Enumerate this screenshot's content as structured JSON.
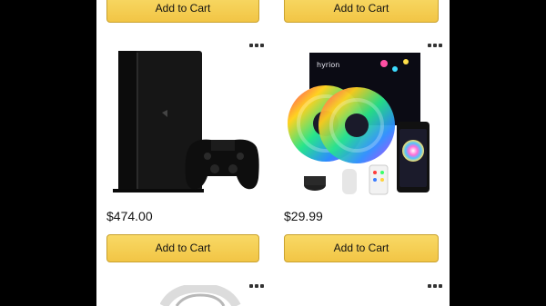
{
  "products": [
    {
      "price": "",
      "cta": "Add to Cart",
      "image": "unknown-product-above"
    },
    {
      "price": "",
      "cta": "Add to Cart",
      "image": "unknown-product-above"
    },
    {
      "price": "$474.00",
      "cta": "Add to Cart",
      "image": "game-console-with-controller"
    },
    {
      "price": "$29.99",
      "cta": "Add to Cart",
      "image": "rgb-led-strip-lights-kit"
    }
  ],
  "led_box_brand": "hyrion",
  "more_label": "More options",
  "icons": {
    "more": "more-options-icon"
  },
  "colors": {
    "button": "#f2c545",
    "button_border": "#c9a230",
    "console": "#141414",
    "price": "#111111"
  }
}
